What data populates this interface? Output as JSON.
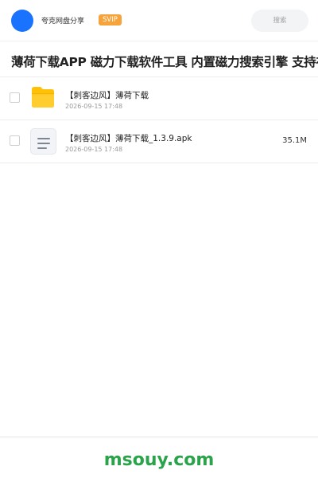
{
  "header": {
    "user_name": "夸克网盘分享",
    "badge": "SVIP",
    "search_placeholder": "搜索",
    "avatar_color": "#1a73ff",
    "badge_color": "#f7a33b"
  },
  "share": {
    "title": "薄荷下载APP 磁力下载软件工具 内置磁力搜索引擎 支持在"
  },
  "files": [
    {
      "name": "【刺客边风】薄荷下载",
      "date": "2026-09-15 17:48",
      "size": "",
      "icon": "folder-icon"
    },
    {
      "name": "【刺客边风】薄荷下载_1.3.9.apk",
      "date": "2026-09-15 17:48",
      "size": "35.1M",
      "icon": "document-icon"
    }
  ],
  "footer": {
    "text": "msouy.com",
    "color": "#2aa34a"
  }
}
